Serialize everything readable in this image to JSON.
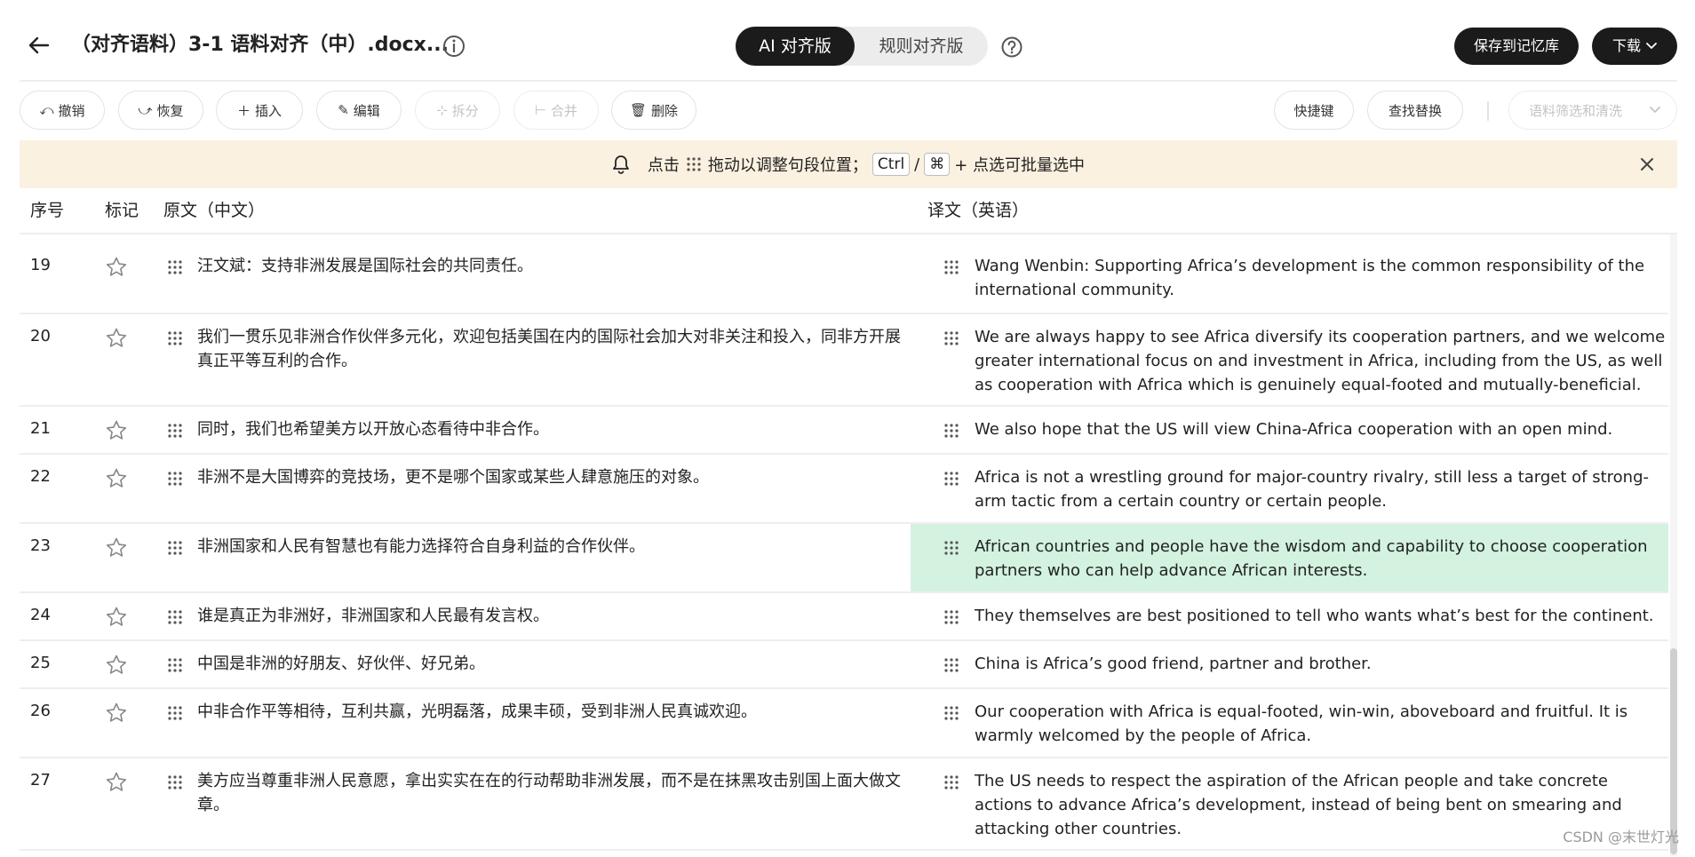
{
  "header": {
    "doc_title": "（对齐语料）3-1 语料对齐（中）.docx...",
    "mode_ai": "AI 对齐版",
    "mode_rule": "规则对齐版",
    "save_label": "保存到记忆库",
    "download_label": "下载"
  },
  "toolbar": {
    "undo": "撤销",
    "redo": "恢复",
    "insert": "插入",
    "edit": "编辑",
    "split": "拆分",
    "merge": "合并",
    "delete": "删除",
    "shortcuts": "快捷键",
    "find_replace": "查找替换",
    "filter_placeholder": "语料筛选和清洗"
  },
  "notice": {
    "part1": "点击",
    "part2": "拖动以调整句段位置；",
    "key_ctrl": "Ctrl",
    "slash": "/",
    "key_cmd": "⌘",
    "part3": "+ 点选可批量选中"
  },
  "table": {
    "col_num": "序号",
    "col_mark": "标记",
    "col_source": "原文（中文）",
    "col_target": "译文（英语）",
    "rows": [
      {
        "num": "19",
        "src": "汪文斌：支持非洲发展是国际社会的共同责任。",
        "tgt": "Wang Wenbin: Supporting Africa’s development is the common responsibility of the international community.",
        "highlight": false
      },
      {
        "num": "20",
        "src": "我们一贯乐见非洲合作伙伴多元化，欢迎包括美国在内的国际社会加大对非关注和投入，同非方开展真正平等互利的合作。",
        "tgt": "We are always happy to see Africa diversify its cooperation partners, and we welcome greater international focus on and investment in Africa, including from the US, as well as cooperation with Africa which is genuinely equal-footed and mutually-beneficial.",
        "highlight": false
      },
      {
        "num": "21",
        "src": "同时，我们也希望美方以开放心态看待中非合作。",
        "tgt": "We also hope that the US will view China-Africa cooperation with an open mind.",
        "highlight": false
      },
      {
        "num": "22",
        "src": "非洲不是大国博弈的竞技场，更不是哪个国家或某些人肆意施压的对象。",
        "tgt": "Africa is not a wrestling ground for major-country rivalry, still less a target of strong-arm tactic from a certain country or certain people.",
        "highlight": false
      },
      {
        "num": "23",
        "src": "非洲国家和人民有智慧也有能力选择符合自身利益的合作伙伴。",
        "tgt": "African countries and people have the wisdom and capability to choose cooperation partners who can help advance African interests.",
        "highlight": true
      },
      {
        "num": "24",
        "src": "谁是真正为非洲好，非洲国家和人民最有发言权。",
        "tgt": "They themselves are best positioned to tell who wants what’s best for the continent.",
        "highlight": false
      },
      {
        "num": "25",
        "src": "中国是非洲的好朋友、好伙伴、好兄弟。",
        "tgt": "China is Africa’s good friend, partner and brother.",
        "highlight": false
      },
      {
        "num": "26",
        "src": "中非合作平等相待，互利共赢，光明磊落，成果丰硕，受到非洲人民真诚欢迎。",
        "tgt": "Our cooperation with Africa is equal-footed, win-win, aboveboard and fruitful. It is warmly welcomed by the people of Africa.",
        "highlight": false
      },
      {
        "num": "27",
        "src": "美方应当尊重非洲人民意愿，拿出实实在在的行动帮助非洲发展，而不是在抹黑攻击别国上面大做文章。",
        "tgt": "The US needs to respect the aspiration of the African people and take concrete actions to advance Africa’s development, instead of being bent on smearing and attacking other countries.",
        "highlight": false
      }
    ]
  },
  "watermark": "CSDN @末世灯光",
  "colors": {
    "accent_dark": "#1b1b1b",
    "notice_bg": "#fbf1e0",
    "highlight_bg": "#d3f2e0"
  }
}
